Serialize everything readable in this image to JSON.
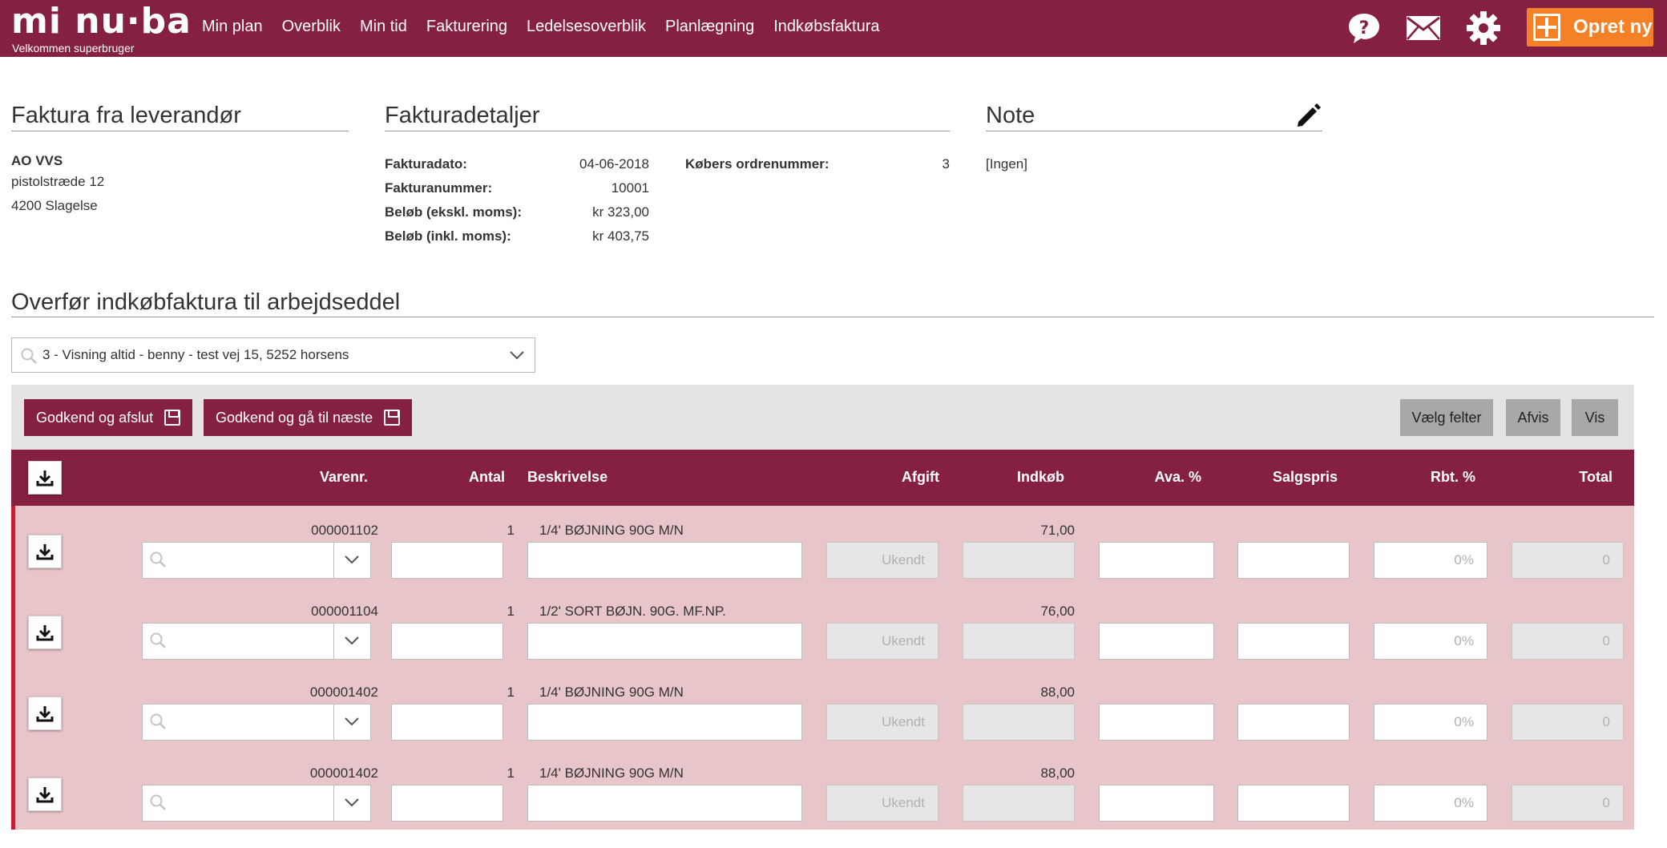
{
  "app": {
    "logo": "mi nu·ba",
    "welcome": "Velkommen  superbruger"
  },
  "nav": [
    "Min plan",
    "Overblik",
    "Min tid",
    "Fakturering",
    "Ledelsesoverblik",
    "Planlægning",
    "Indkøbsfaktura"
  ],
  "header_icons": [
    "help-icon",
    "mail-icon",
    "gear-icon"
  ],
  "create_button": "Opret ny",
  "colors": {
    "brand": "#862040",
    "accent": "#f58025",
    "row_bg": "#e8c5c8",
    "row_marker": "#c01f35"
  },
  "supplier": {
    "title": "Faktura fra leverandør",
    "name": "AO VVS",
    "street": "pistolstræde 12",
    "city": "4200 Slagelse"
  },
  "details": {
    "title": "Fakturadetaljer",
    "invoice_date_label": "Fakturadato:",
    "invoice_date": "04-06-2018",
    "invoice_number_label": "Fakturanummer:",
    "invoice_number": "10001",
    "amount_excl_label": "Beløb (ekskl. moms):",
    "amount_excl": "kr 323,00",
    "amount_incl_label": "Beløb (inkl. moms):",
    "amount_incl": "kr 403,75",
    "buyer_order_label": "Købers ordrenummer:",
    "buyer_order": "3"
  },
  "note": {
    "title": "Note",
    "text": "[Ingen]"
  },
  "transfer": {
    "title": "Overfør indkøbfaktura til arbejdseddel",
    "selected_workorder": "3 - Visning altid - benny - test vej 15, 5252 horsens"
  },
  "actions": {
    "approve_close": "Godkend og afslut",
    "approve_next": "Godkend og gå til næste",
    "choose_fields": "Vælg felter",
    "reject": "Afvis",
    "show": "Vis"
  },
  "table": {
    "columns": [
      "Varenr.",
      "Antal",
      "Beskrivelse",
      "Afgift",
      "Indkøb",
      "Ava. %",
      "Salgspris",
      "Rbt. %",
      "Total"
    ],
    "rows": [
      {
        "item_no": "000001102",
        "qty": "1",
        "description": "1/4' BØJNING 90G M/N",
        "fee_placeholder": "Ukendt",
        "purchase": "71,00",
        "discount_placeholder": "0%",
        "total_placeholder": "0"
      },
      {
        "item_no": "000001104",
        "qty": "1",
        "description": "1/2' SORT BØJN. 90G. MF.NP.",
        "fee_placeholder": "Ukendt",
        "purchase": "76,00",
        "discount_placeholder": "0%",
        "total_placeholder": "0"
      },
      {
        "item_no": "000001402",
        "qty": "1",
        "description": "1/4' BØJNING 90G M/N",
        "fee_placeholder": "Ukendt",
        "purchase": "88,00",
        "discount_placeholder": "0%",
        "total_placeholder": "0"
      },
      {
        "item_no": "000001402",
        "qty": "1",
        "description": "1/4' BØJNING 90G M/N",
        "fee_placeholder": "Ukendt",
        "purchase": "88,00",
        "discount_placeholder": "0%",
        "total_placeholder": "0"
      }
    ]
  }
}
